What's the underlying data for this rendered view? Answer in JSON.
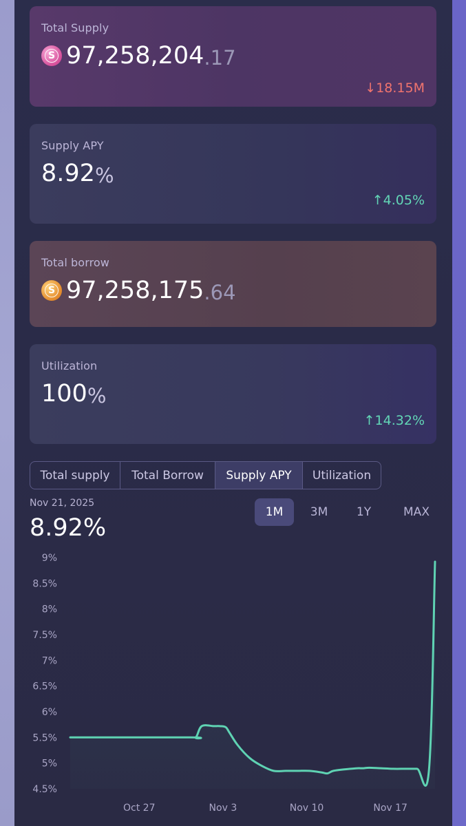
{
  "cards": {
    "total_supply": {
      "label": "Total Supply",
      "coin": "S",
      "value_int": "97,258,204",
      "value_dec": ".17",
      "change": "↓18.15M",
      "change_color": "#f0746e"
    },
    "supply_apy": {
      "label": "Supply APY",
      "value_int": "8.92",
      "value_suffix": "%",
      "change": "↑4.05%",
      "change_color": "#62d6b6"
    },
    "total_borrow": {
      "label": "Total borrow",
      "coin": "S",
      "value_int": "97,258,175",
      "value_dec": ".64"
    },
    "utilization": {
      "label": "Utilization",
      "value_int": "100",
      "value_suffix": "%",
      "change": "↑14.32%",
      "change_color": "#62d6b6"
    }
  },
  "tabs": [
    {
      "label": "Total supply",
      "active": false
    },
    {
      "label": "Total Borrow",
      "active": false
    },
    {
      "label": "Supply APY",
      "active": true
    },
    {
      "label": "Utilization",
      "active": false
    }
  ],
  "selected": {
    "date": "Nov 21, 2025",
    "value": "8.92%"
  },
  "ranges": [
    {
      "label": "1M",
      "active": true
    },
    {
      "label": "3M",
      "active": false
    },
    {
      "label": "1Y",
      "active": false
    },
    {
      "label": "MAX",
      "active": false
    }
  ],
  "chart_data": {
    "type": "line",
    "ytick_labels": [
      "9%",
      "8.5%",
      "8%",
      "7.5%",
      "7%",
      "6.5%",
      "6%",
      "5.5%",
      "5%",
      "4.5%"
    ],
    "yticks": [
      9,
      8.5,
      8,
      7.5,
      7,
      6.5,
      6,
      5.5,
      5,
      4.5
    ],
    "ylim": [
      4.5,
      9
    ],
    "xtick_labels": [
      "Oct 27",
      "Nov 3",
      "Nov 10",
      "Nov 17"
    ],
    "xticks": [
      6,
      13,
      20,
      27
    ],
    "xlim": [
      0,
      30.5
    ],
    "line_color": "#5fd3b3",
    "grid": false,
    "series": [
      {
        "x": [
          0,
          10,
          10.5,
          11,
          12,
          12.5,
          13,
          13.3,
          14,
          15,
          16,
          17,
          18,
          19,
          20,
          21,
          21.5,
          22,
          23,
          24,
          24.5,
          25,
          26,
          27,
          28,
          29,
          30,
          30.5
        ],
        "y": [
          5.5,
          5.5,
          5.5,
          5.72,
          5.72,
          5.72,
          5.7,
          5.6,
          5.35,
          5.1,
          4.95,
          4.85,
          4.85,
          4.85,
          4.85,
          4.82,
          4.8,
          4.85,
          4.88,
          4.9,
          4.9,
          4.91,
          4.9,
          4.89,
          4.89,
          4.89,
          4.88,
          8.92
        ]
      }
    ]
  }
}
